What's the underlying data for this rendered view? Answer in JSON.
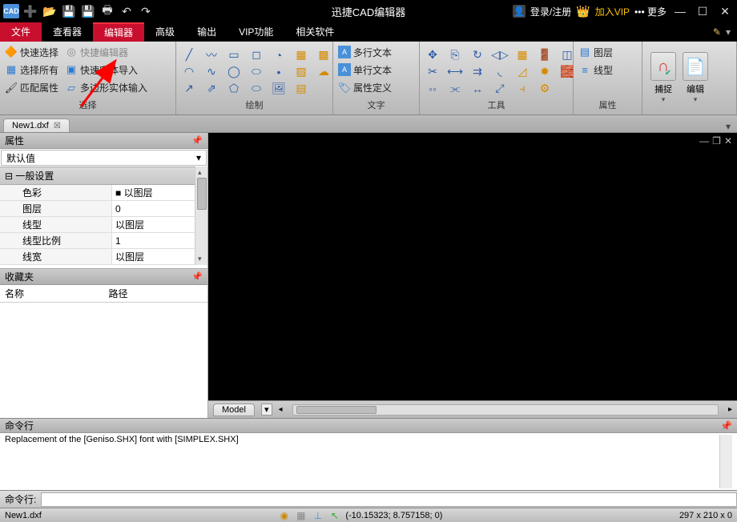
{
  "app": {
    "title": "迅捷CAD编辑器"
  },
  "titlebar": {
    "cad": "CAD",
    "login": "登录/注册",
    "vip": "加入VIP",
    "more": "更多"
  },
  "menu": {
    "file": "文件",
    "viewer": "查看器",
    "editor": "编辑器",
    "advanced": "高级",
    "output": "输出",
    "vip": "VIP功能",
    "related": "相关软件"
  },
  "ribbon": {
    "select": {
      "quick_select": "快速选择",
      "quick_editor": "快捷编辑器",
      "select_all": "选择所有",
      "quick_entity_import": "快速实体导入",
      "match_props": "匹配属性",
      "polygon_entity_input": "多边形实体输入",
      "label": "选择"
    },
    "draw": {
      "label": "绘制"
    },
    "text": {
      "multiline": "多行文本",
      "singleline": "单行文本",
      "attrdef": "属性定义",
      "label": "文字"
    },
    "tools": {
      "label": "工具"
    },
    "props": {
      "layers": "图层",
      "linetype": "线型",
      "label": "属性"
    },
    "capture": "捕捉",
    "edit": "编辑"
  },
  "filetab": {
    "name": "New1.dxf"
  },
  "properties": {
    "header": "属性",
    "dropdown": "默认值",
    "section_general": "一般设置",
    "rows": [
      {
        "k": "色彩",
        "v": "■ 以图层"
      },
      {
        "k": "图层",
        "v": "0"
      },
      {
        "k": "线型",
        "v": "以图层"
      },
      {
        "k": "线型比例",
        "v": "1"
      },
      {
        "k": "线宽",
        "v": "以图层"
      }
    ]
  },
  "favorites": {
    "header": "收藏夹",
    "col_name": "名称",
    "col_path": "路径"
  },
  "model_tab": "Model",
  "cmd": {
    "header": "命令行",
    "history": "Replacement of the [Geniso.SHX] font with [SIMPLEX.SHX]",
    "label": "命令行:"
  },
  "status": {
    "file": "New1.dxf",
    "coords": "(-10.15323; 8.757158; 0)",
    "dims": "297 x 210 x 0"
  }
}
